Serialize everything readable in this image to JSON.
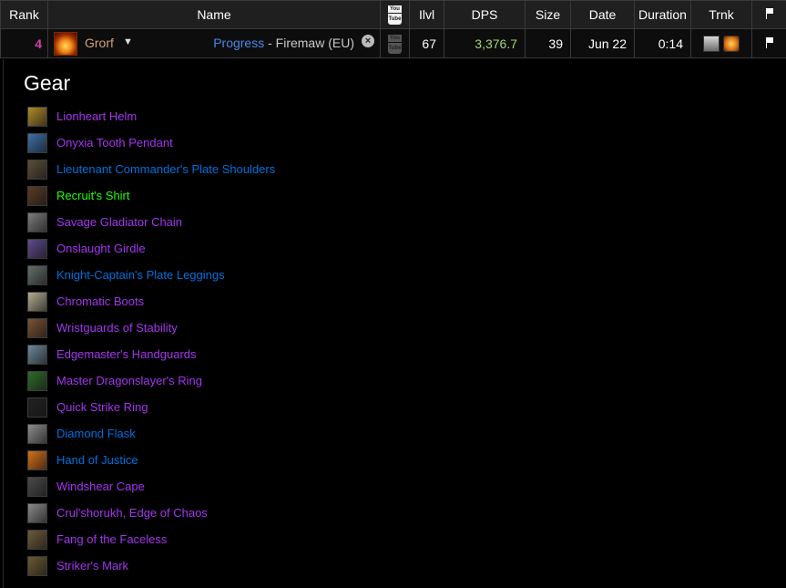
{
  "headers": {
    "rank": "Rank",
    "name": "Name",
    "ilvl": "Ilvl",
    "dps": "DPS",
    "size": "Size",
    "date": "Date",
    "duration": "Duration",
    "trnk": "Trnk"
  },
  "row": {
    "rank": "4",
    "player": "Grorf",
    "progress_link": "Progress",
    "realm": " - Firemaw (EU)",
    "ilvl": "67",
    "dps": "3,376.7",
    "size": "39",
    "date": "Jun 22",
    "duration": "0:14"
  },
  "colors": {
    "rank": "#d33ea8",
    "player": "#d2a17a",
    "link": "#4a86e8",
    "dps": "#9fd66f",
    "epic": "#a335ee",
    "rare": "#0070dd",
    "uncommon": "#1eff00"
  },
  "gear": {
    "title": "Gear",
    "items": [
      {
        "name": "Lionheart Helm",
        "quality": "epic",
        "icon": "helm-icon",
        "bg": "#b08a2a"
      },
      {
        "name": "Onyxia Tooth Pendant",
        "quality": "epic",
        "icon": "pendant-icon",
        "bg": "#3d6fa8"
      },
      {
        "name": "Lieutenant Commander's Plate Shoulders",
        "quality": "rare",
        "icon": "shoulders-icon",
        "bg": "#5b4e3b"
      },
      {
        "name": "Recruit's Shirt",
        "quality": "uncommon",
        "icon": "shirt-icon",
        "bg": "#5a3c24"
      },
      {
        "name": "Savage Gladiator Chain",
        "quality": "epic",
        "icon": "chest-icon",
        "bg": "#7d7d7d"
      },
      {
        "name": "Onslaught Girdle",
        "quality": "epic",
        "icon": "belt-icon",
        "bg": "#5d4a8c"
      },
      {
        "name": "Knight-Captain's Plate Leggings",
        "quality": "rare",
        "icon": "legs-icon",
        "bg": "#64706a"
      },
      {
        "name": "Chromatic Boots",
        "quality": "epic",
        "icon": "boots-icon",
        "bg": "#b3ab92"
      },
      {
        "name": "Wristguards of Stability",
        "quality": "epic",
        "icon": "wrist-icon",
        "bg": "#7a5233"
      },
      {
        "name": "Edgemaster's Handguards",
        "quality": "epic",
        "icon": "hands-icon",
        "bg": "#6d8899"
      },
      {
        "name": "Master Dragonslayer's Ring",
        "quality": "epic",
        "icon": "ring-icon",
        "bg": "#2f6b2a"
      },
      {
        "name": "Quick Strike Ring",
        "quality": "epic",
        "icon": "ring-icon",
        "bg": "#222222"
      },
      {
        "name": "Diamond Flask",
        "quality": "rare",
        "icon": "flask-icon",
        "bg": "#8d8d8d"
      },
      {
        "name": "Hand of Justice",
        "quality": "rare",
        "icon": "trinket-icon",
        "bg": "#d3701a"
      },
      {
        "name": "Windshear Cape",
        "quality": "epic",
        "icon": "cape-icon",
        "bg": "#4a4a4a"
      },
      {
        "name": "Crul'shorukh, Edge of Chaos",
        "quality": "epic",
        "icon": "axe-icon",
        "bg": "#8a8a8a"
      },
      {
        "name": "Fang of the Faceless",
        "quality": "epic",
        "icon": "dagger-icon",
        "bg": "#6e5a3a"
      },
      {
        "name": "Striker's Mark",
        "quality": "epic",
        "icon": "bow-icon",
        "bg": "#6b5a33"
      }
    ]
  }
}
